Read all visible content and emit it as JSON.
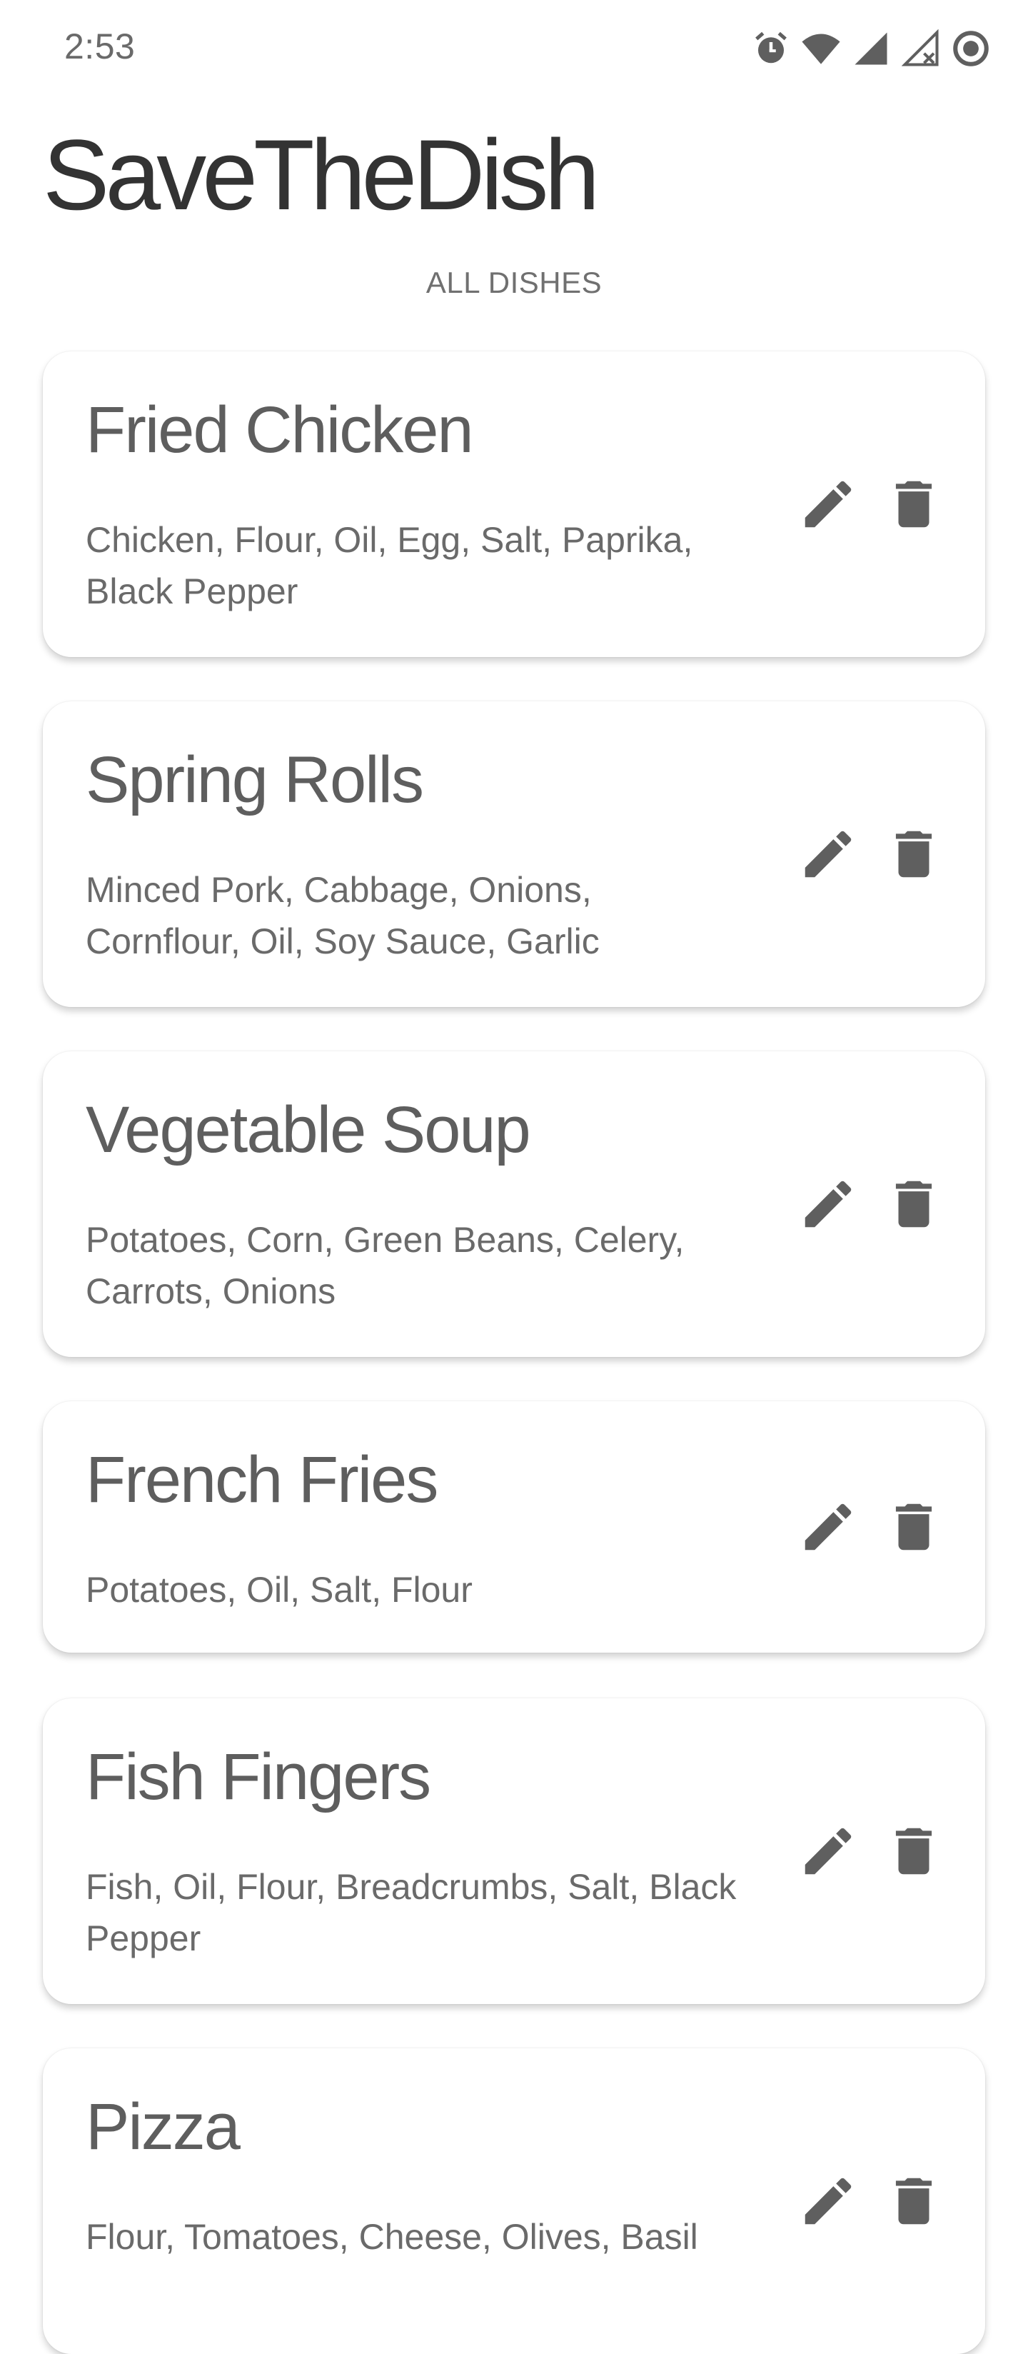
{
  "status_bar": {
    "time": "2:53",
    "icons": [
      "alarm-icon",
      "wifi-icon",
      "cell-signal-icon",
      "cell-signal-no-data-icon",
      "sync-icon"
    ]
  },
  "app": {
    "title": "SaveTheDish"
  },
  "list": {
    "section_label": "ALL DISHES",
    "dishes": [
      {
        "name": "Fried Chicken",
        "ingredients": "Chicken, Flour, Oil, Egg, Salt, Paprika, Black Pepper"
      },
      {
        "name": "Spring Rolls",
        "ingredients": "Minced Pork, Cabbage, Onions, Cornflour, Oil, Soy Sauce, Garlic"
      },
      {
        "name": "Vegetable Soup",
        "ingredients": "Potatoes, Corn, Green Beans, Celery, Carrots, Onions"
      },
      {
        "name": "French Fries",
        "ingredients": "Potatoes, Oil, Salt, Flour"
      },
      {
        "name": "Fish Fingers",
        "ingredients": "Fish, Oil, Flour, Breadcrumbs, Salt, Black Pepper"
      },
      {
        "name": "Pizza",
        "ingredients": "Flour, Tomatoes, Cheese, Olives, Basil"
      }
    ],
    "actions": {
      "edit_icon": "pencil-icon",
      "delete_icon": "trash-icon"
    }
  },
  "colors": {
    "title": "#333333",
    "text": "#5e5e5e",
    "icon": "#5f5f5f",
    "background": "#ffffff"
  }
}
